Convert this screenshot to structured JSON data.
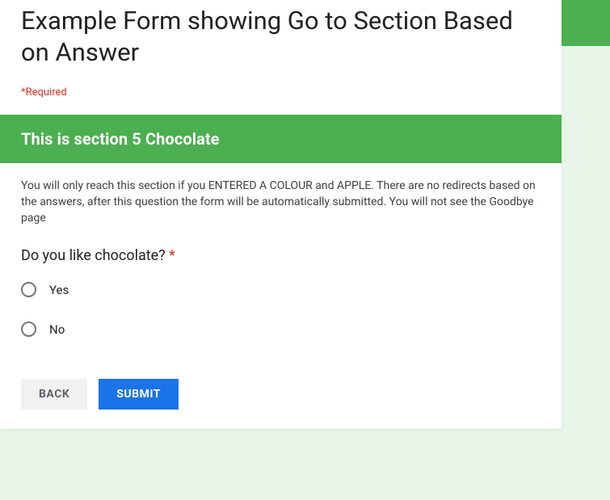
{
  "form": {
    "title": "Example Form showing Go to Section Based on Answer",
    "required_note": "*Required"
  },
  "section": {
    "title": "This is section 5 Chocolate",
    "description": "You will only reach this section if you ENTERED A COLOUR and  APPLE.  There are no redirects based on the answers, after this question the form will be automatically submitted.  You will not see the Goodbye page"
  },
  "question": {
    "label": "Do you like chocolate? ",
    "required_mark": "*",
    "options": [
      {
        "label": "Yes"
      },
      {
        "label": "No"
      }
    ]
  },
  "actions": {
    "back": "BACK",
    "submit": "SUBMIT"
  }
}
